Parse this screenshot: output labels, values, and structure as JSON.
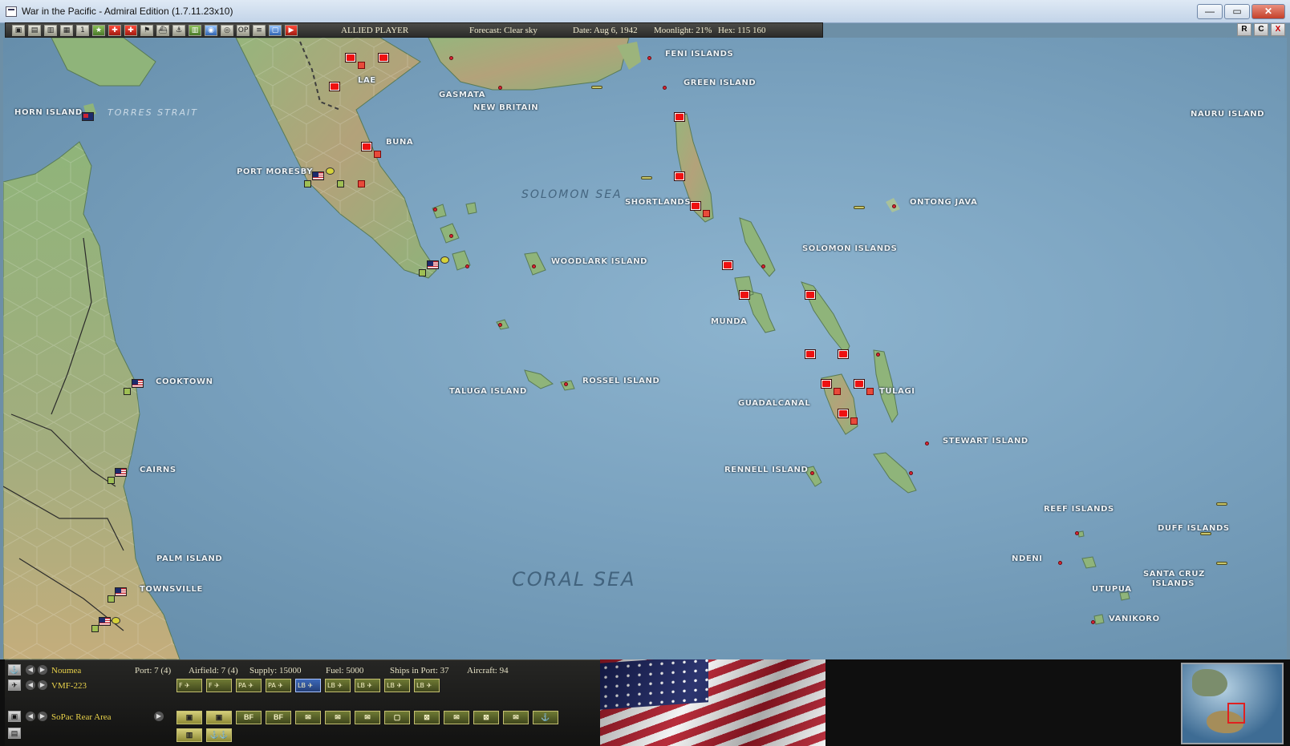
{
  "window": {
    "title": "War in the Pacific - Admiral Edition (1.7.11.23x10)",
    "buttons": [
      "—",
      "▭",
      "✕"
    ]
  },
  "toolbar": {
    "icons": [
      "▣",
      "▤",
      "▥",
      "▦",
      "1",
      "★",
      "✚",
      "✚",
      "⚑",
      "⛴",
      "⚓",
      "▥",
      "◉",
      "◎",
      "OP",
      "≡",
      "▢"
    ],
    "player": "ALLIED PLAYER",
    "forecast": "Forecast: Clear sky",
    "date": "Date: Aug 6, 1942",
    "moonlight": "Moonlight: 21%",
    "hex": "Hex: 115 160",
    "right_buttons": [
      "R",
      "C",
      "X"
    ]
  },
  "map": {
    "seas": {
      "solomon": "SOLOMON SEA",
      "coral": "CORAL SEA",
      "torres": "TORRES STRAIT"
    },
    "places": {
      "feni": "FENI ISLANDS",
      "green": "GREEN ISLAND",
      "lae": "LAE",
      "gasmata": "GASMATA",
      "new_britain": "NEW BRITAIN",
      "horn": "HORN ISLAND",
      "nauru": "NAURU ISLAND",
      "buna": "BUNA",
      "port_moresby": "PORT MORESBY",
      "shortlands": "SHORTLANDS",
      "ontong": "ONTONG JAVA",
      "woodlark": "WOODLARK ISLAND",
      "solomon_islands": "SOLOMON ISLANDS",
      "munda": "MUNDA",
      "cooktown": "COOKTOWN",
      "taluga": "TALUGA ISLAND",
      "rossel": "ROSSEL ISLAND",
      "guadalcanal": "GUADALCANAL",
      "tulagi": "TULAGI",
      "stewart": "STEWART ISLAND",
      "cairns": "CAIRNS",
      "rennell": "RENNELL ISLAND",
      "reef": "REEF ISLANDS",
      "duff": "DUFF ISLANDS",
      "palm": "PALM ISLAND",
      "ndeni": "NDENI",
      "santa_cruz_1": "SANTA CRUZ",
      "santa_cruz_2": "ISLANDS",
      "townsville": "TOWNSVILLE",
      "utupua": "UTUPUA",
      "vanikoro": "VANIKORO"
    }
  },
  "bottom": {
    "base_name": "Noumea",
    "port": "Port: 7 (4)",
    "airfield": "Airfield: 7 (4)",
    "supply": "Supply: 15000",
    "fuel": "Fuel: 5000",
    "ships_in_port": "Ships in Port: 37",
    "aircraft": "Aircraft: 94",
    "air_unit": "VMF-223",
    "air_buttons": [
      "F ✈",
      "F ✈",
      "PA ✈",
      "PA ✈",
      "LB ✈",
      "LB ✈",
      "LB ✈",
      "LB ✈",
      "LB ✈"
    ],
    "hq": "SoPac Rear Area",
    "area_buttons": [
      "▣",
      "▣",
      "BF",
      "BF",
      "✉",
      "✉",
      "✉",
      "▢",
      "⊠",
      "✉",
      "⊠",
      "✉",
      "⚓"
    ],
    "misc_buttons": [
      "▥",
      "⚓⚓"
    ]
  },
  "colors": {
    "sea": "#7aa2bf",
    "land": "#8fb27a",
    "japan_marker": "#e11111",
    "allied_marker": "#1d2a6b",
    "panel_text": "#e9d24a"
  }
}
